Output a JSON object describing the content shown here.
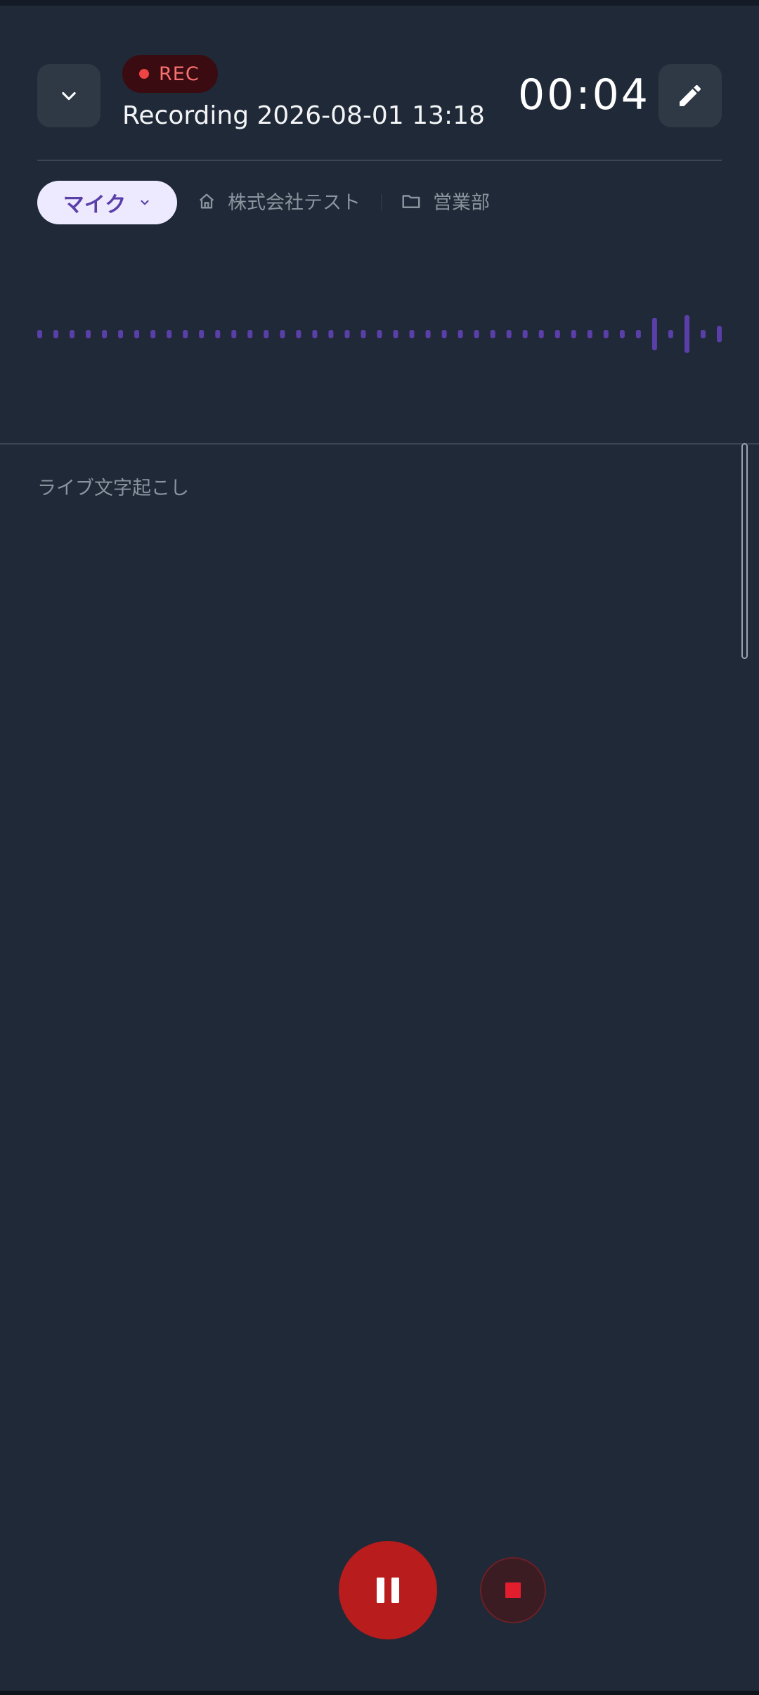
{
  "header": {
    "rec_label": "REC",
    "title": "Recording 2026-08-01 13:18",
    "timer": "00:04",
    "collapse_icon": "chevron-down-icon",
    "edit_icon": "pencil-icon"
  },
  "source": {
    "mic_label": "マイク",
    "company": "株式会社テスト",
    "department": "営業部"
  },
  "waveform": {
    "bar_color": "#5b3fa8",
    "levels": [
      0.15,
      0.15,
      0.15,
      0.15,
      0.15,
      0.15,
      0.15,
      0.15,
      0.15,
      0.15,
      0.15,
      0.15,
      0.15,
      0.15,
      0.15,
      0.15,
      0.15,
      0.15,
      0.15,
      0.15,
      0.15,
      0.15,
      0.15,
      0.15,
      0.15,
      0.15,
      0.15,
      0.15,
      0.15,
      0.15,
      0.15,
      0.15,
      0.15,
      0.15,
      0.15,
      0.15,
      0.15,
      0.15,
      0.6,
      0.15,
      0.7,
      0.15,
      0.3
    ]
  },
  "transcript": {
    "label": "ライブ文字起こし"
  },
  "controls": {
    "pause_icon": "pause-icon",
    "stop_icon": "stop-icon"
  },
  "colors": {
    "background": "#1f2937",
    "rec_red": "#ef4444",
    "accent_purple": "#5b3fa8",
    "pause_red": "#b91c1c"
  }
}
